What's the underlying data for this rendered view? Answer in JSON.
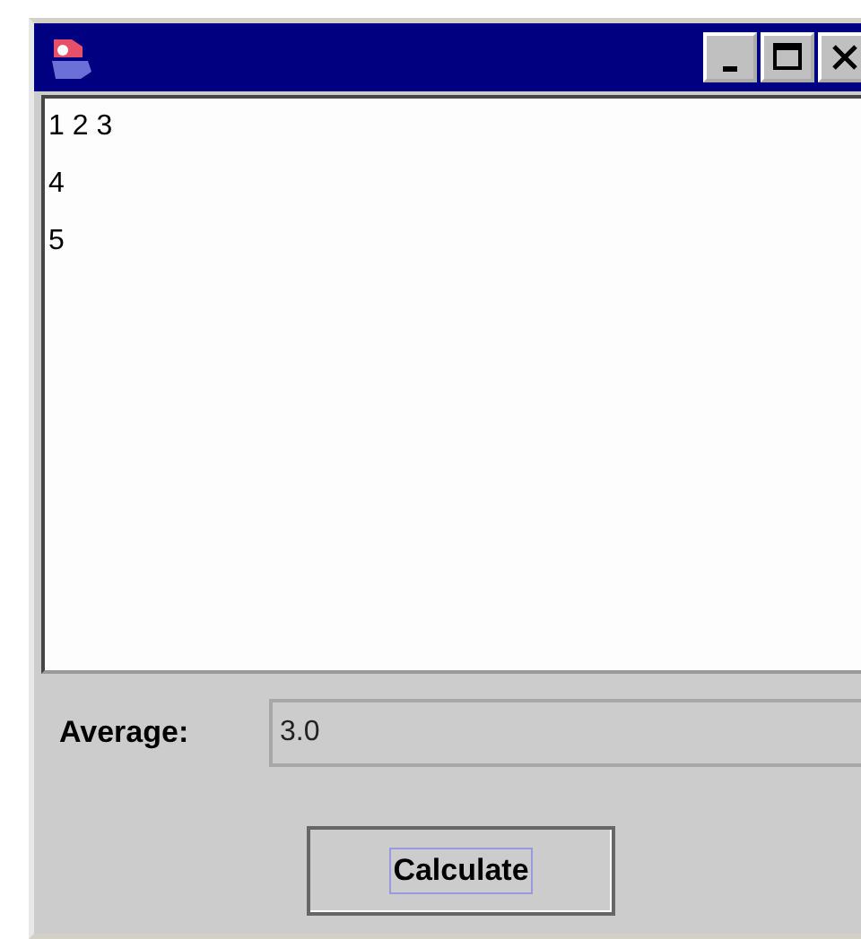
{
  "window": {
    "title_bar": {
      "controls": [
        {
          "kind": "minimize"
        },
        {
          "kind": "maximize"
        },
        {
          "kind": "close"
        }
      ]
    }
  },
  "text_area": {
    "lines": [
      "1 2 3",
      "4",
      "5"
    ]
  },
  "average": {
    "label": "Average:",
    "value": "3.0"
  },
  "button": {
    "label": "Calculate",
    "focused": true
  }
}
